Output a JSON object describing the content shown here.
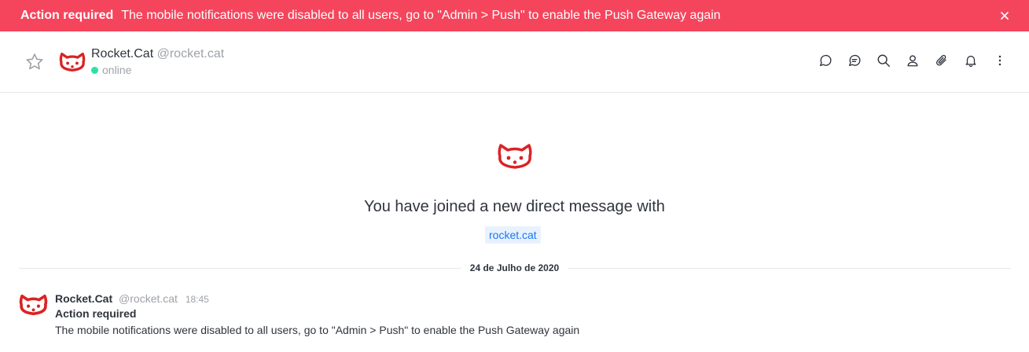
{
  "banner": {
    "title": "Action required",
    "text": "The mobile notifications were disabled to all users, go to \"Admin > Push\" to enable the Push Gateway again",
    "color": "#f5455c"
  },
  "room": {
    "name": "Rocket.Cat",
    "username": "@rocket.cat",
    "status": "online",
    "status_color": "#2de0a5"
  },
  "toolbar": {
    "icons": [
      "discussion-icon",
      "threads-icon",
      "search-icon",
      "members-icon",
      "attachment-icon",
      "notifications-icon",
      "kebab-menu-icon"
    ]
  },
  "welcome": {
    "text": "You have joined a new direct message with",
    "mention": "rocket.cat"
  },
  "divider": {
    "date": "24 de Julho de 2020"
  },
  "message": {
    "author": "Rocket.Cat",
    "username": "@rocket.cat",
    "time": "18:45",
    "title": "Action required",
    "body": "The mobile notifications were disabled to all users, go to \"Admin > Push\" to enable the Push Gateway again"
  },
  "colors": {
    "brand_red": "#f5455c",
    "mention_bg": "#e8f2ff",
    "mention_text": "#1d74f5",
    "muted": "#9ea2a8"
  }
}
